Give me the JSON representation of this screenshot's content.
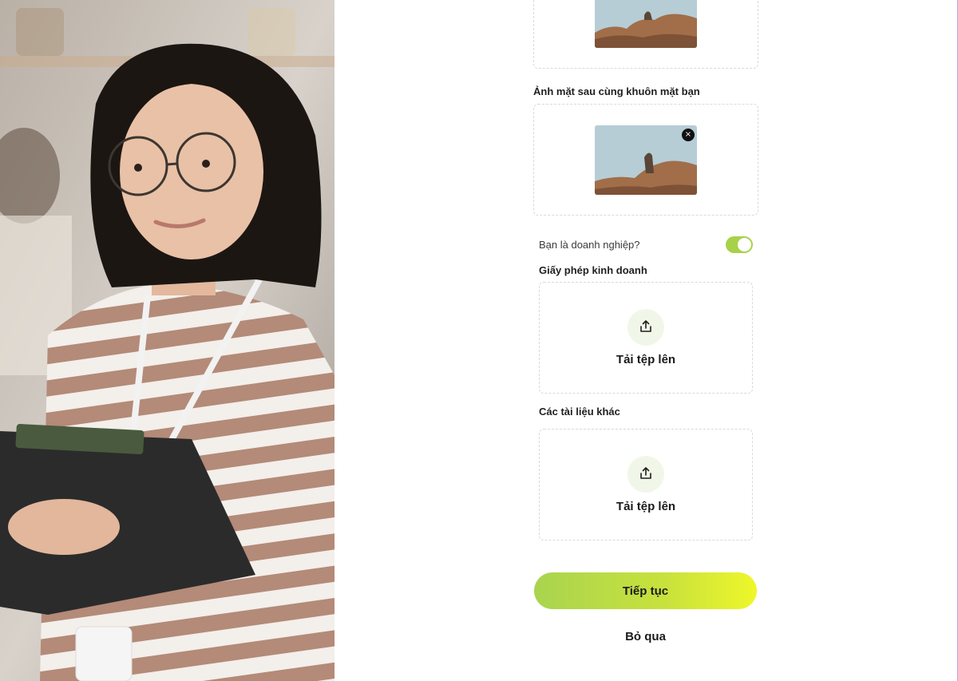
{
  "hero": {
    "alt": "Woman with glasses holding a clipboard"
  },
  "front_id": {
    "thumbnail": "ibex-on-rock-photo"
  },
  "back_id": {
    "label": "Ảnh mặt sau cùng khuôn mặt bạn",
    "thumbnail": "ibex-on-rock-photo",
    "remove_label": "×"
  },
  "business": {
    "question": "Bạn là doanh nghiệp?",
    "is_business": true,
    "toggle_color": "#a8d14a"
  },
  "license": {
    "label": "Giấy phép kinh doanh",
    "upload_text": "Tải tệp lên",
    "icon": "upload-icon"
  },
  "other_docs": {
    "label": "Các tài liệu khác",
    "upload_text": "Tải tệp lên",
    "icon": "upload-icon"
  },
  "actions": {
    "continue_label": "Tiếp tục",
    "skip_label": "Bỏ qua",
    "accent_gradient": [
      "#a9d44f",
      "#eef72a"
    ]
  }
}
